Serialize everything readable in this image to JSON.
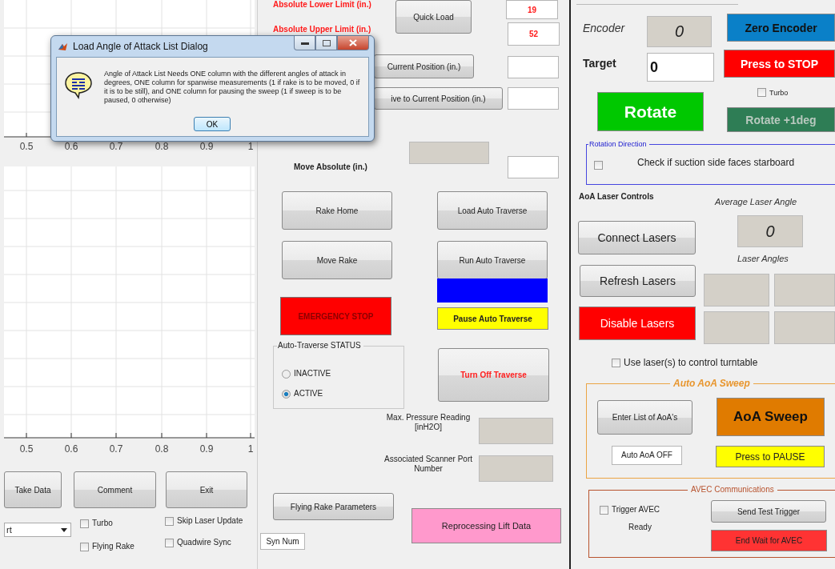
{
  "left_panel": {
    "top_plot": {
      "xtick_labels": [
        "0.5",
        "0.6",
        "0.7",
        "0.8",
        "0.9",
        "1"
      ]
    },
    "bottom_plot": {
      "xtick_labels": [
        "0.5",
        "0.6",
        "0.7",
        "0.8",
        "0.9",
        "1"
      ]
    },
    "buttons": [
      "Take Data",
      "Comment",
      "Exit"
    ],
    "dropdown": {
      "value": "rt"
    },
    "checkboxes": [
      {
        "label": "Turbo",
        "checked": false
      },
      {
        "label": "Flying Rake",
        "checked": false
      },
      {
        "label": "Skip Laser Update",
        "checked": false
      },
      {
        "label": "Quadwire Sync",
        "checked": false
      }
    ]
  },
  "middle_panel": {
    "lower_limit": {
      "label": "Absolute Lower Limit (in.)",
      "value": "19"
    },
    "upper_limit": {
      "label": "Absolute Upper Limit (in.)",
      "value": "52"
    },
    "move_absolute_label": "Move Absolute (in.)",
    "buttons": [
      {
        "label": "Quick Load",
        "kind": "standard"
      },
      {
        "label": "Current Position (in.)",
        "kind": "standard"
      },
      {
        "label": "ive to Current Position (in.)",
        "kind": "standard"
      },
      {
        "label": "Rake Home",
        "kind": "standard"
      },
      {
        "label": "Load Auto Traverse",
        "kind": "standard"
      },
      {
        "label": "Move Rake",
        "kind": "standard"
      },
      {
        "label": "Run Auto Traverse",
        "kind": "standard"
      },
      {
        "label": "EMERGENCY STOP",
        "kind": "emergency"
      },
      {
        "label": "Pause Auto Traverse",
        "kind": "warning"
      },
      {
        "label": "Turn Off Traverse",
        "kind": "alert-text"
      },
      {
        "label": "Flying Rake Parameters",
        "kind": "standard"
      },
      {
        "label": "Reprocessing Lift Data",
        "kind": "pink"
      }
    ],
    "status_group": {
      "title": "Auto-Traverse STATUS",
      "options": [
        {
          "label": "INACTIVE",
          "selected": false
        },
        {
          "label": "ACTIVE",
          "selected": true
        }
      ]
    },
    "readouts": [
      {
        "label": "Max. Pressure Reading [inH2O]"
      },
      {
        "label": "Associated Scanner Port Number"
      }
    ],
    "syn_num": "Syn Num"
  },
  "right_panel": {
    "encoder": {
      "label": "Encoder",
      "value": "0"
    },
    "target": {
      "label": "Target",
      "value": "0"
    },
    "buttons": [
      {
        "label": "Zero Encoder",
        "kind": "blue",
        "disabled": false
      },
      {
        "label": "Press to STOP",
        "kind": "red",
        "disabled": false
      },
      {
        "label": "Rotate",
        "kind": "green",
        "disabled": false
      },
      {
        "label": "Rotate +1deg",
        "kind": "darkgreen",
        "disabled": true
      }
    ],
    "turbo": {
      "label": "Turbo",
      "checked": false
    },
    "rotation_direction": {
      "title": "Rotation Direction",
      "checkbox": {
        "label": "Check if suction side faces starboard",
        "checked": false
      }
    },
    "laser_controls": {
      "title": "AoA Laser Controls",
      "average_label": "Average Laser Angle",
      "average_value": "0",
      "angles_label": "Laser Angles",
      "buttons": [
        {
          "label": "Connect Lasers",
          "kind": "standard"
        },
        {
          "label": "Refresh Lasers",
          "kind": "standard"
        },
        {
          "label": "Disable Lasers",
          "kind": "red"
        }
      ],
      "use_lasers": {
        "label": "Use laser(s) to control turntable",
        "checked": false
      }
    },
    "sweep": {
      "title": "Auto AoA Sweep",
      "enter_button": "Enter List of AoA's",
      "sweep_button": "AoA Sweep",
      "status": "Auto AoA OFF",
      "pause_button": "Press to PAUSE"
    },
    "avec": {
      "title": "AVEC Communications",
      "trigger": {
        "label": "Trigger AVEC",
        "checked": false
      },
      "status": "Ready",
      "test_button": "Send Test Trigger",
      "end_button": "End Wait for AVEC"
    }
  },
  "dialog": {
    "title": "Load Angle of Attack List Dialog",
    "message": "Angle of Attack List Needs ONE column with the different angles of attack in degrees, ONE column for spanwise measurements (1 if rake is to be moved, 0 if it is to be still), and ONE column for pausing the sweep (1 if sweep is to be paused, 0 otherwise)",
    "button": "OK"
  }
}
